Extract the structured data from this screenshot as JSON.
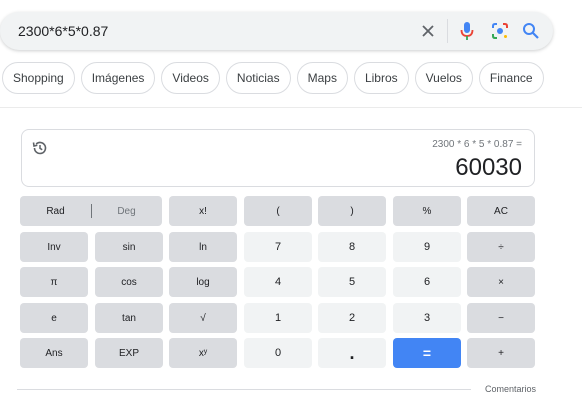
{
  "search": {
    "query": "2300*6*5*0.87"
  },
  "chips": [
    "Shopping",
    "Imágenes",
    "Videos",
    "Noticias",
    "Maps",
    "Libros",
    "Vuelos",
    "Finance"
  ],
  "calculator": {
    "expression": "2300 * 6 * 5 * 0.87 =",
    "result": "60030",
    "mode_rad": "Rad",
    "mode_deg": "Deg",
    "keys": {
      "fact": "x!",
      "lparen": "(",
      "rparen": ")",
      "percent": "%",
      "ac": "AC",
      "inv": "Inv",
      "sin": "sin",
      "ln": "ln",
      "k7": "7",
      "k8": "8",
      "k9": "9",
      "div": "÷",
      "pi": "π",
      "cos": "cos",
      "log": "log",
      "k4": "4",
      "k5": "5",
      "k6": "6",
      "mul": "×",
      "e": "e",
      "tan": "tan",
      "sqrt": "√",
      "k1": "1",
      "k2": "2",
      "k3": "3",
      "minus": "−",
      "ans": "Ans",
      "exp": "EXP",
      "pow": "xʸ",
      "k0": "0",
      "dot": ".",
      "equals": "=",
      "plus": "+"
    }
  },
  "footer": {
    "feedback": "Comentarios"
  },
  "colors": {
    "accent": "#4285f4",
    "fn_key": "#dadce0",
    "num_key": "#f1f3f4"
  }
}
